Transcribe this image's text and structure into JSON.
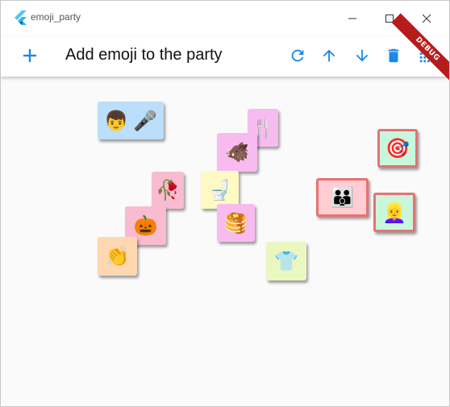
{
  "window": {
    "title": "emoji_party"
  },
  "appbar": {
    "title": "Add emoji to the party",
    "actions": [
      "add-icon",
      "refresh-icon",
      "arrow-up-icon",
      "arrow-down-icon",
      "delete-icon",
      "grid-icon"
    ],
    "accent": "#1e88e5"
  },
  "debug_banner": "DEBUG",
  "tiles": [
    {
      "name": "boy-mic",
      "emoji": [
        "👦",
        "🎤"
      ],
      "bg": "#bbdefb",
      "selected": false
    },
    {
      "name": "cutlery",
      "emoji": [
        "🍴"
      ],
      "bg": "#f8bbf0",
      "selected": false
    },
    {
      "name": "boar",
      "emoji": [
        "🐗"
      ],
      "bg": "#f8bbf0",
      "selected": false
    },
    {
      "name": "dart",
      "emoji": [
        "🎯"
      ],
      "bg": "#c8f7dc",
      "selected": true
    },
    {
      "name": "flower",
      "emoji": [
        "🥀"
      ],
      "bg": "#f8bbd0",
      "selected": false
    },
    {
      "name": "toilet",
      "emoji": [
        "🚽"
      ],
      "bg": "#fff9c4",
      "selected": false
    },
    {
      "name": "family",
      "emoji": [
        "👪"
      ],
      "bg": "#ffcdd2",
      "selected": true
    },
    {
      "name": "woman",
      "emoji": [
        "👱‍♀️"
      ],
      "bg": "#c8f7dc",
      "selected": true
    },
    {
      "name": "pumpkin",
      "emoji": [
        "🎃"
      ],
      "bg": "#f8bbd0",
      "selected": false
    },
    {
      "name": "pancakes",
      "emoji": [
        "🥞"
      ],
      "bg": "#f8bbf0",
      "selected": false
    },
    {
      "name": "clap",
      "emoji": [
        "👏"
      ],
      "bg": "#ffd7b0",
      "selected": false
    },
    {
      "name": "shirt",
      "emoji": [
        "👕"
      ],
      "bg": "#eaf7c0",
      "selected": false
    }
  ]
}
